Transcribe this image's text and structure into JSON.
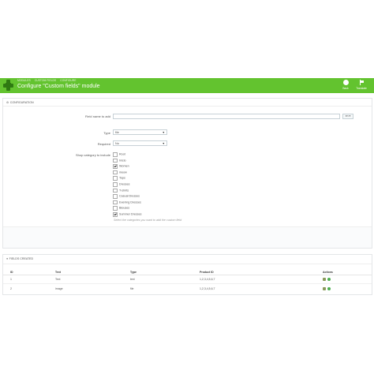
{
  "header": {
    "breadcrumbs": [
      "MODULES",
      "CUSTOM FIELDS",
      "CONFIGURE"
    ],
    "title": "Configure \"Custom fields\" module",
    "back_label": "Back",
    "translate_label": "Translate"
  },
  "config": {
    "section_title": "CONFIGURATION",
    "field_name_label": "Field name to add",
    "field_name_value": "",
    "lang_value": "en",
    "type_label": "Type",
    "type_value": "file",
    "required_label": "Required",
    "required_value": "No",
    "shop_category_label": "Shop category to include",
    "categories": [
      {
        "label": "Root",
        "checked": false
      },
      {
        "label": "Inicio",
        "checked": false
      },
      {
        "label": "Women",
        "checked": true
      },
      {
        "label": "meow",
        "checked": false
      },
      {
        "label": "Tops",
        "checked": false
      },
      {
        "label": "Dresses",
        "checked": false
      },
      {
        "label": "T-shirts",
        "checked": false
      },
      {
        "label": "Casual Dresses",
        "checked": false
      },
      {
        "label": "Evening Dresses",
        "checked": false
      },
      {
        "label": "Blouses",
        "checked": false
      },
      {
        "label": "Summer Dresses",
        "checked": true
      }
    ],
    "hint": "Select the categories you want to add the custom field"
  },
  "fields": {
    "section_title": "FIELDS CREATED",
    "columns": [
      "ID",
      "Text",
      "Type",
      "Product ID",
      "Actions"
    ],
    "rows": [
      {
        "id": "1",
        "text": "Text",
        "type": "text",
        "product_id": "1,2,3,4,5,6,7"
      },
      {
        "id": "2",
        "text": "image",
        "type": "file",
        "product_id": "1,2,3,4,5,6,7"
      }
    ]
  },
  "colors": {
    "header_green": "#63c32f",
    "edit_icon": "#8a9a5b",
    "delete_icon": "#4caf50"
  }
}
